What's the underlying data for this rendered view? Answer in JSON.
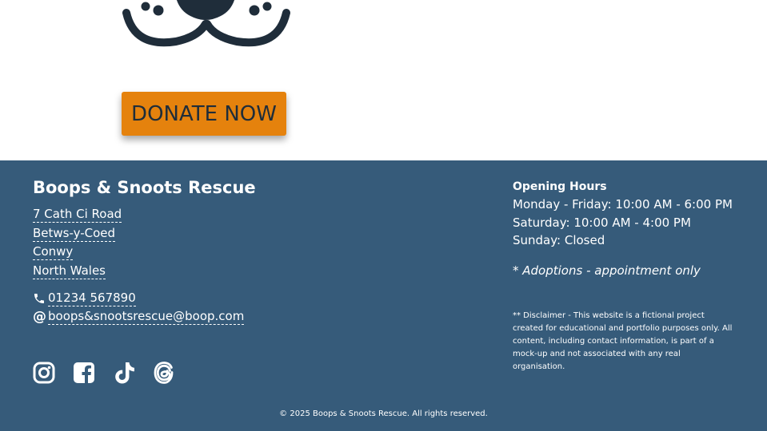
{
  "hero": {
    "donate_label": "DONATE NOW"
  },
  "footer": {
    "org_name": "Boops & Snoots Rescue",
    "address": [
      "7 Cath Ci Road",
      "Betws-y-Coed",
      "Conwy",
      "North Wales"
    ],
    "phone": "01234 567890",
    "email_symbol": "@",
    "email": "boops&snootsrescue@boop.com",
    "social_icons": [
      "instagram-icon",
      "facebook-icon",
      "tiktok-icon",
      "threads-icon"
    ],
    "hours_title": "Opening Hours",
    "hours": [
      "Monday - Friday: 10:00 AM - 6:00 PM",
      "Saturday: 10:00 AM - 4:00 PM",
      "Sunday: Closed"
    ],
    "adoptions_note": "* Adoptions - appointment only",
    "disclaimer": "** Disclaimer - This website is a fictional project created for educational and portfolio purposes only. All content, including contact information, is part of a mock-up and not associated with any real organisation.",
    "copyright": "© 2025 Boops & Snoots Rescue. All rights reserved."
  },
  "colors": {
    "footer_bg": "#365b7a",
    "donate_bg": "#e5820d",
    "logo": "#1f2d3a"
  }
}
